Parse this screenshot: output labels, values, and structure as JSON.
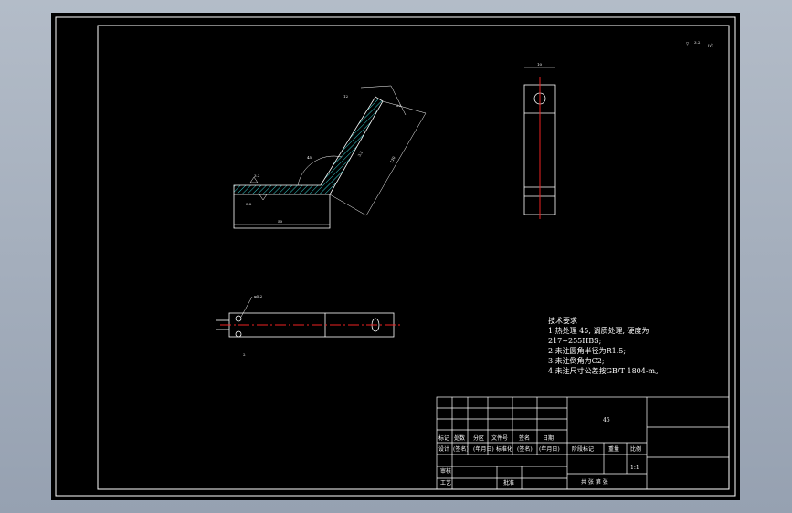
{
  "drawing": {
    "roughness_note": "▽ ",
    "roughness_note_suffix": "(√)",
    "dim_labels": {
      "d1": "10",
      "d2": "15",
      "d3": "2",
      "d4": "20",
      "d5": "45",
      "d6": "80",
      "d7": "120",
      "d8": "50",
      "d9": "3.2",
      "d10": "12",
      "d11": "1.5",
      "d12": "R1.5",
      "d13": "36",
      "d14": "5",
      "d15": "φ5.2",
      "d16": "2"
    }
  },
  "technical_requirements": {
    "title": "技术要求",
    "items": [
      "1.热处理 45, 调质处理, 硬度为",
      "217~255HBS;",
      "2.未注圆角半径为R1.5;",
      "3.未注倒角为C2;",
      "4.未注尺寸公差按GB/T 1804-m。"
    ]
  },
  "title_block": {
    "material": "45",
    "header_row": [
      "标记",
      "处数",
      "分区",
      "文件号",
      "签名",
      "日期"
    ],
    "design_row": [
      "设计",
      "(签名)",
      "(年月日)",
      "标准化",
      "(签名)",
      "(年月日)"
    ],
    "stage_label": "阶段标记",
    "weight_label": "重量",
    "scale_label": "比例",
    "scale": "1:1",
    "review": "审核",
    "process": "工艺",
    "approve": "批准",
    "sheets": "共 张 第 张"
  }
}
